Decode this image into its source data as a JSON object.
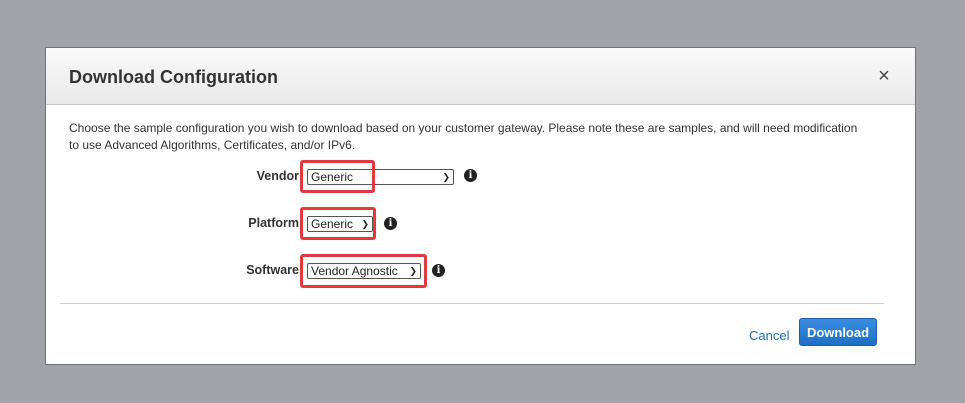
{
  "dialog": {
    "title": "Download Configuration",
    "close_symbol": "×",
    "description": "Choose the sample configuration you wish to download based on your customer gateway. Please note these are samples, and will need modification to use Advanced Algorithms, Certificates, and/or IPv6."
  },
  "form": {
    "vendor": {
      "label": "Vendor",
      "selected": "Generic"
    },
    "platform": {
      "label": "Platform",
      "selected": "Generic"
    },
    "software": {
      "label": "Software",
      "selected": "Vendor Agnostic"
    },
    "info_symbol": "i"
  },
  "actions": {
    "cancel_label": "Cancel",
    "download_label": "Download"
  },
  "colors": {
    "backdrop": "#a0a4a9",
    "highlight": "#e0393e",
    "primary_button": "#2a7fd4",
    "link": "#1f6fb7"
  },
  "icons": [
    "close-icon",
    "info-icon",
    "chevron-down-icon"
  ]
}
